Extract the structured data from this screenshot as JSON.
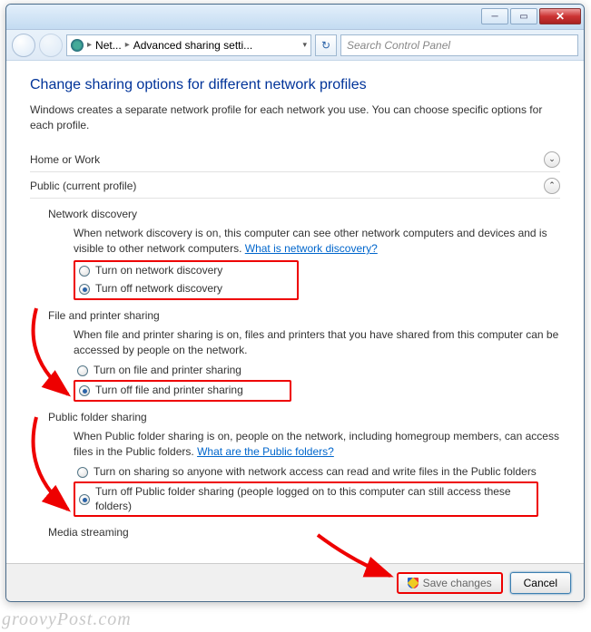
{
  "breadcrumb": {
    "seg1": "Net...",
    "seg2": "Advanced sharing setti..."
  },
  "search": {
    "placeholder": "Search Control Panel"
  },
  "page": {
    "title": "Change sharing options for different network profiles",
    "intro": "Windows creates a separate network profile for each network you use. You can choose specific options for each profile."
  },
  "profiles": {
    "home": "Home or Work",
    "public": "Public (current profile)"
  },
  "sections": {
    "netdisc": {
      "title": "Network discovery",
      "body_pre": "When network discovery is on, this computer can see other network computers and devices and is visible to other network computers. ",
      "link": "What is network discovery?",
      "opt_on": "Turn on network discovery",
      "opt_off": "Turn off network discovery"
    },
    "fileprint": {
      "title": "File and printer sharing",
      "body": "When file and printer sharing is on, files and printers that you have shared from this computer can be accessed by people on the network.",
      "opt_on": "Turn on file and printer sharing",
      "opt_off": "Turn off file and printer sharing"
    },
    "pubfolder": {
      "title": "Public folder sharing",
      "body_pre": "When Public folder sharing is on, people on the network, including homegroup members, can access files in the Public folders. ",
      "link": "What are the Public folders?",
      "opt_on": "Turn on sharing so anyone with network access can read and write files in the Public folders",
      "opt_off": "Turn off Public folder sharing (people logged on to this computer can still access these folders)"
    },
    "media": {
      "title": "Media streaming"
    }
  },
  "footer": {
    "save": "Save changes",
    "cancel": "Cancel"
  },
  "watermark": "groovyPost.com"
}
